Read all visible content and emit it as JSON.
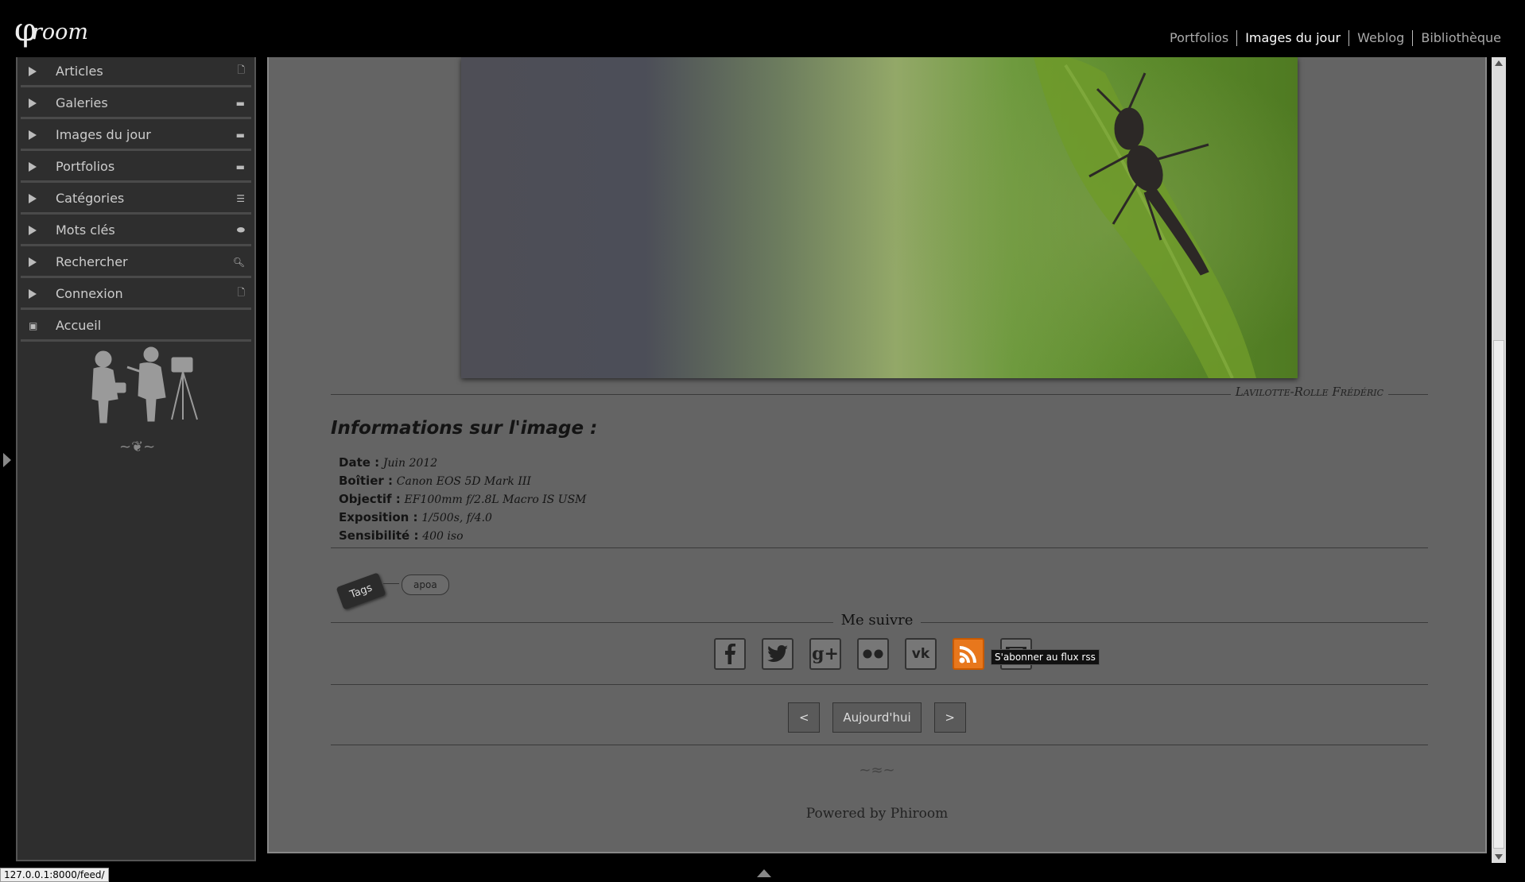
{
  "header": {
    "logo_symbol": "φ",
    "logo_text": "room",
    "nav": [
      "Portfolios",
      "Images du jour",
      "Weblog",
      "Bibliothèque"
    ]
  },
  "sidebar": {
    "items": [
      {
        "label": "Articles",
        "icon": "document-icon"
      },
      {
        "label": "Galeries",
        "icon": "folder-icon"
      },
      {
        "label": "Images du jour",
        "icon": "folder-icon"
      },
      {
        "label": "Portfolios",
        "icon": "folder-icon"
      },
      {
        "label": "Catégories",
        "icon": "list-icon"
      },
      {
        "label": "Mots clés",
        "icon": "tag-icon"
      },
      {
        "label": "Rechercher",
        "icon": "search-icon"
      },
      {
        "label": "Connexion",
        "icon": "document-icon"
      },
      {
        "label": "Accueil",
        "icon": "home-icon"
      }
    ]
  },
  "photo": {
    "credit": "Lavilotte-Rolle Frédéric"
  },
  "info": {
    "title": "Informations sur l'image :",
    "date_label": "Date :",
    "date_value": "Juin 2012",
    "body_label": "Boîtier :",
    "body_value": "Canon EOS 5D Mark III",
    "lens_label": "Objectif :",
    "lens_value": "EF100mm f/2.8L Macro IS USM",
    "exposure_label": "Exposition :",
    "exposure_value": "1/500s, f/4.0",
    "iso_label": "Sensibilité :",
    "iso_value": "400 iso"
  },
  "tags": {
    "label": "Tags",
    "items": [
      "apoa"
    ]
  },
  "follow": {
    "title": "Me suivre",
    "networks": [
      "facebook",
      "twitter",
      "google-plus",
      "flickr",
      "vk",
      "rss",
      "email"
    ],
    "tooltip": "S'abonner au flux rss"
  },
  "pager": {
    "prev": "<",
    "today": "Aujourd'hui",
    "next": ">"
  },
  "footer": {
    "powered": "Powered by Phiroom"
  },
  "status_bar": {
    "url": "127.0.0.1:8000/feed/"
  }
}
